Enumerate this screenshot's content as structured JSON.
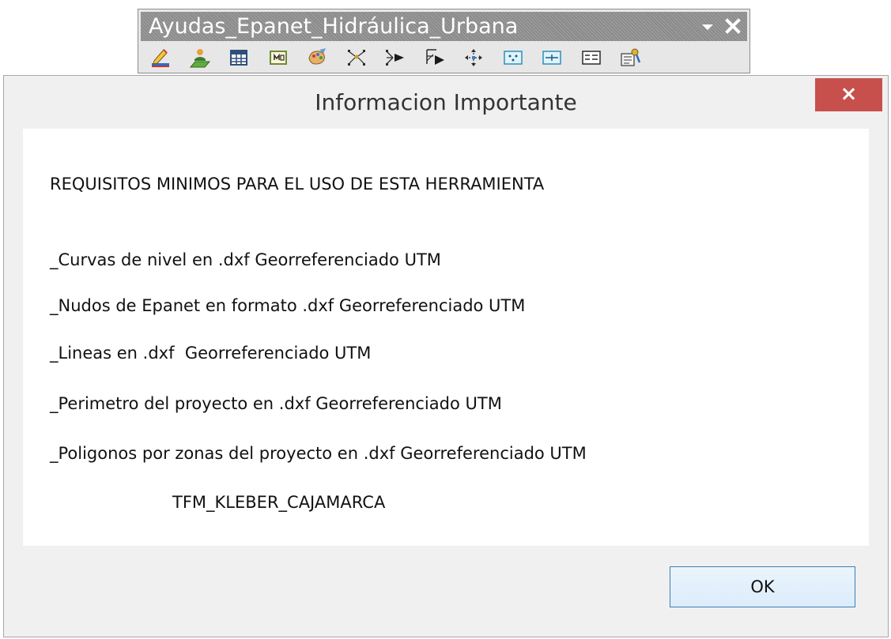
{
  "toolbar": {
    "title": "Ayudas_Epanet_Hidráulica_Urbana",
    "menu_icon": "dropdown-arrow-icon",
    "close_icon": "close-icon",
    "tools": [
      {
        "icon": "edit-pencil-icon"
      },
      {
        "icon": "add-user-icon"
      },
      {
        "icon": "table-icon"
      },
      {
        "icon": "map-sheet-icon"
      },
      {
        "icon": "paint-palette-icon"
      },
      {
        "icon": "scatter-points-icon"
      },
      {
        "icon": "flow-arrow-icon"
      },
      {
        "icon": "select-arrow-icon"
      },
      {
        "icon": "move-nodes-icon"
      },
      {
        "icon": "node-grid-icon"
      },
      {
        "icon": "line-grid-icon"
      },
      {
        "icon": "list-fields-icon"
      },
      {
        "icon": "settings-tool-icon"
      }
    ]
  },
  "dialog": {
    "title": "Informacion Importante",
    "close_label": "×",
    "heading": "REQUISITOS MINIMOS PARA EL USO DE ESTA HERRAMIENTA",
    "requirements": [
      "_Curvas de nivel en .dxf Georreferenciado UTM",
      "_Nudos de Epanet en formato .dxf Georreferenciado UTM",
      "_Lineas en .dxf  Georreferenciado UTM",
      "_Perimetro del proyecto en .dxf Georreferenciado UTM",
      "_Poligonos por zonas del proyecto en .dxf Georreferenciado UTM"
    ],
    "signature": "TFM_KLEBER_CAJAMARCA",
    "ok_label": "OK"
  },
  "colors": {
    "close_button": "#c7504c",
    "ok_border": "#3c7fb1",
    "dialog_background": "#f0f0f0",
    "toolbar_title_background": "#8b8b8b"
  }
}
